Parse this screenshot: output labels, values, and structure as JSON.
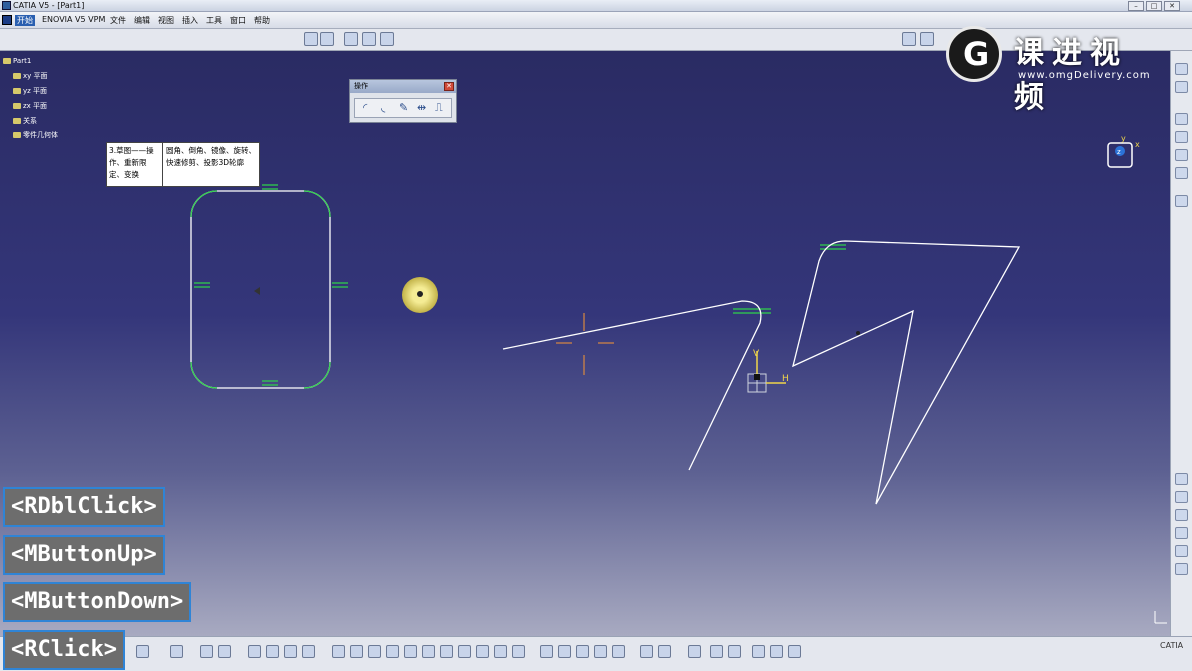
{
  "window": {
    "title": "CATIA V5 - [Part1]",
    "controls": [
      "–",
      "□",
      "✕"
    ]
  },
  "menubar": {
    "items": [
      "开始",
      "ENOVIA V5 VPM",
      "文件",
      "编辑",
      "视图",
      "插入",
      "工具",
      "窗口",
      "帮助"
    ]
  },
  "tree": {
    "root": "Part1",
    "items": [
      "xy 平面",
      "yz 平面",
      "zx 平面",
      "关系",
      "零件几何体"
    ]
  },
  "ops_toolbar": {
    "title": "操作",
    "close": "✕",
    "icons": [
      "corner-icon",
      "chamfer-icon",
      "trim-icon",
      "mirror-icon",
      "project-3d-icon"
    ]
  },
  "annotation": {
    "left_cell": "3.草图——操作、重新限定、变换",
    "right_cell": "圆角、倒角、镜像、旋转、快速修剪、投影3D轮廓"
  },
  "brand": {
    "name": "课进视频",
    "url": "www.omgDelivery.com"
  },
  "compass": {
    "axis_x": "x",
    "axis_y": "y",
    "axis_z": "z"
  },
  "sketch_labels": {
    "axis_h": "H",
    "axis_v": "V"
  },
  "bottom": {
    "logo": "CATIA"
  },
  "key_overlays": [
    "<RDblClick>",
    "<MButtonUp>",
    "<MButtonDown>",
    "<RClick>"
  ],
  "colors": {
    "viewport_top": "#2a2b63",
    "sketch_line": "#ffffff",
    "constraint": "#2fd24a",
    "overlay_border": "#2f84d6"
  }
}
